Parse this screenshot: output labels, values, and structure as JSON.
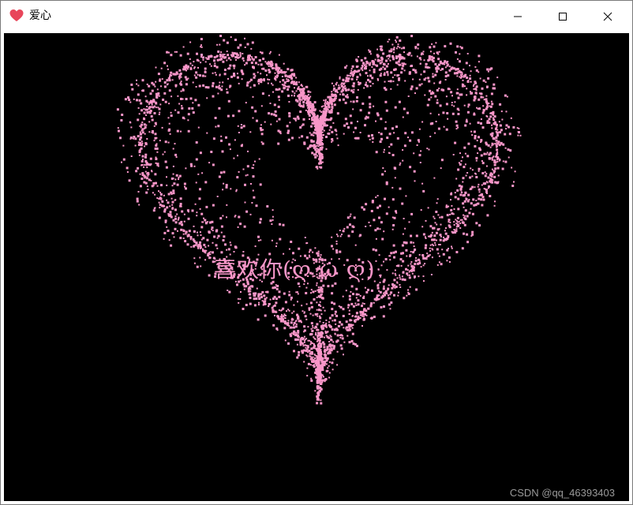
{
  "window": {
    "title": "爱心",
    "icon": "heart-icon",
    "controls": {
      "minimize": "minimize-icon",
      "maximize": "maximize-icon",
      "close": "close-icon"
    }
  },
  "canvas": {
    "background": "#000000",
    "particle_color": "#f896c8",
    "center_text": "喜欢你(ღ ω ღ)",
    "watermark": "CSDN @qq_46393403"
  },
  "colors": {
    "heart_icon": "#e8455a",
    "particles": "#f896c8",
    "text": "#f896c8"
  }
}
